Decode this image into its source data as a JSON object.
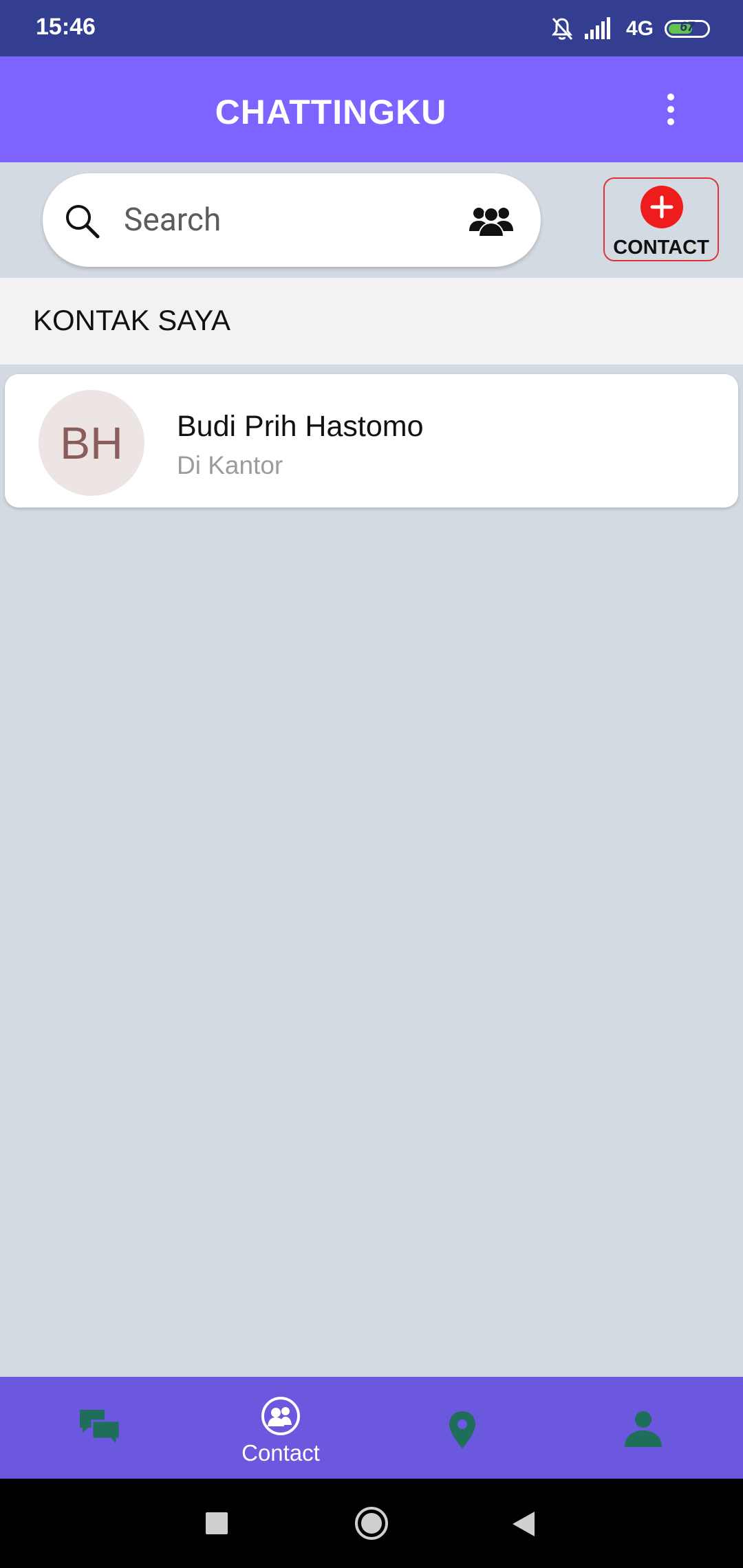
{
  "status_bar": {
    "time": "15:46",
    "network": "4G",
    "battery": "67",
    "battery_level": 0.67,
    "icons": [
      "bell-off-icon",
      "signal-icon",
      "battery-icon"
    ]
  },
  "app_bar": {
    "title": "CHATTINGKU",
    "menu_icon": "more-vert-icon"
  },
  "search": {
    "placeholder": "Search",
    "value": "",
    "icon": "search-icon",
    "action_icon": "group-icon"
  },
  "add_contact": {
    "label": "CONTACT",
    "icon": "add-circle-icon"
  },
  "section": {
    "title": "KONTAK SAYA"
  },
  "contacts": [
    {
      "initials": "BH",
      "name": "Budi Prih Hastomo",
      "status": "Di Kantor"
    }
  ],
  "bottom_nav": {
    "items": [
      {
        "icon": "chat-icon",
        "label": ""
      },
      {
        "icon": "contact-icon",
        "label": "Contact",
        "active": true
      },
      {
        "icon": "location-pin-icon",
        "label": ""
      },
      {
        "icon": "profile-icon",
        "label": ""
      }
    ]
  },
  "colors": {
    "status_bar": "#333e90",
    "app_bar": "#7d63ff",
    "bottom_nav": "#6c57df",
    "background": "#d3dae2",
    "accent_red": "#ee1c1c",
    "nav_icon_green": "#1f6e5a"
  }
}
